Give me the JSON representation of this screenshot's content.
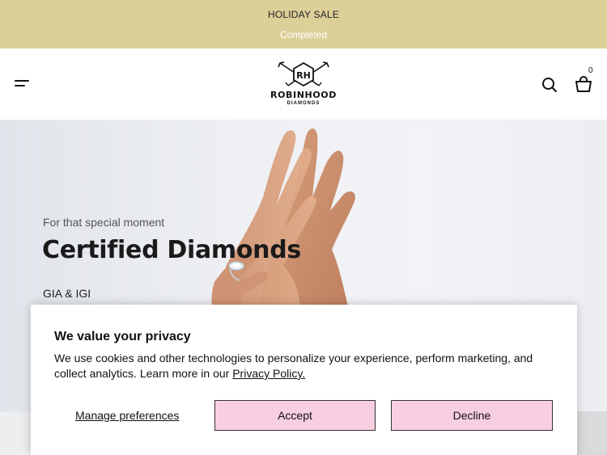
{
  "announcement": {
    "title": "HOLIDAY SALE",
    "subtitle": "Completed"
  },
  "header": {
    "logo_monogram": "RH",
    "logo_brand": "ROBINHOOD",
    "logo_sub": "DIAMONDS",
    "cart_count": "0",
    "icons": [
      "menu-icon",
      "search-icon",
      "shopping-bag-icon"
    ]
  },
  "hero": {
    "kicker": "For that special moment",
    "headline": "Certified Diamonds",
    "tag": "GIA & IGI"
  },
  "cookie_banner": {
    "title": "We value your privacy",
    "body": "We use cookies and other technologies to personalize your experience, perform marketing, and collect analytics. Learn more in our ",
    "policy_link": "Privacy Policy.",
    "manage_label": "Manage preferences",
    "accept_label": "Accept",
    "decline_label": "Decline"
  },
  "colors": {
    "announcement_bg": "#dccf98",
    "button_bg": "#f8cfe0",
    "text": "#111111"
  }
}
